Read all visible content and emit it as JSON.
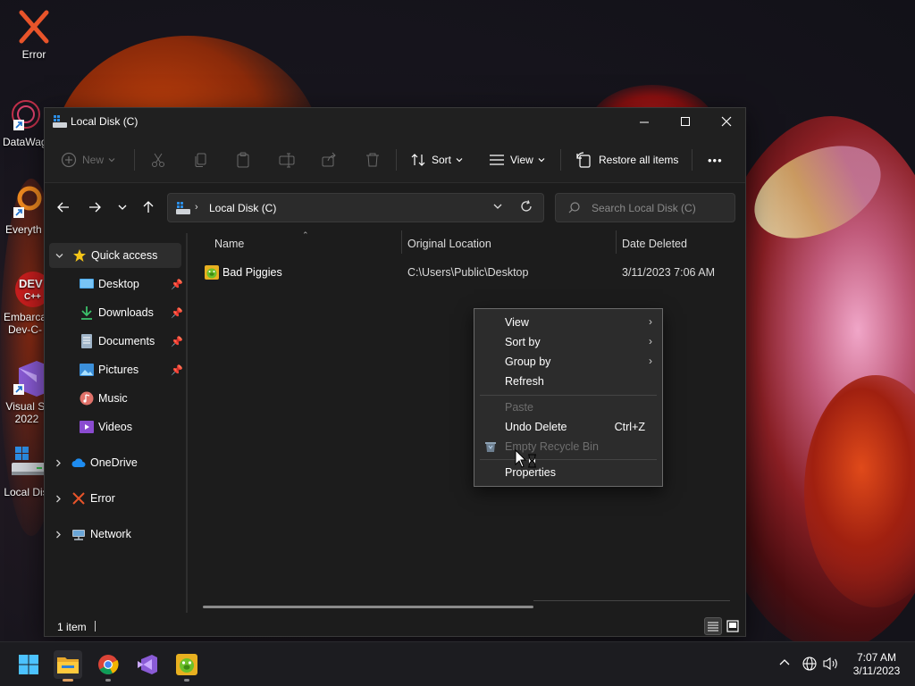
{
  "desktop": {
    "icons": [
      {
        "label": "Error",
        "icon": "red-x-icon"
      },
      {
        "label": "DataWag",
        "icon": "datawag-icon"
      },
      {
        "label": "Everyth",
        "icon": "everything-search-icon"
      },
      {
        "label": "Embarca Dev-C-",
        "icon": "devcpp-icon"
      },
      {
        "label": "Visual St 2022",
        "icon": "visual-studio-icon"
      },
      {
        "label": "Local Dis",
        "icon": "drive-icon"
      }
    ]
  },
  "window": {
    "title": "Local Disk (C)",
    "controls": {
      "minimize": "─",
      "maximize": "☐",
      "close": "✕"
    }
  },
  "toolbar": {
    "new_label": "New",
    "sort_label": "Sort",
    "view_label": "View",
    "restore_label": "Restore all items",
    "more_label": "•••"
  },
  "navigation": {
    "address_text": "Local Disk (C)",
    "search_placeholder": "Search Local Disk (C)"
  },
  "sidebar": {
    "items": [
      {
        "label": "Quick access",
        "icon": "star-icon",
        "expanded": true
      },
      {
        "label": "Desktop",
        "icon": "desktop-folder-icon",
        "pinned": true
      },
      {
        "label": "Downloads",
        "icon": "download-icon",
        "pinned": true
      },
      {
        "label": "Documents",
        "icon": "documents-icon",
        "pinned": true
      },
      {
        "label": "Pictures",
        "icon": "pictures-icon",
        "pinned": true
      },
      {
        "label": "Music",
        "icon": "music-icon"
      },
      {
        "label": "Videos",
        "icon": "videos-icon"
      },
      {
        "label": "OneDrive",
        "icon": "cloud-icon"
      },
      {
        "label": "Error",
        "icon": "red-x-icon"
      },
      {
        "label": "Network",
        "icon": "network-icon"
      }
    ]
  },
  "file_list": {
    "columns": [
      "Name",
      "Original Location",
      "Date Deleted"
    ],
    "rows": [
      {
        "name": "Bad Piggies",
        "location": "C:\\Users\\Public\\Desktop",
        "date": "3/11/2023 7:06 AM"
      }
    ]
  },
  "status": {
    "count": "1 item"
  },
  "context_menu": {
    "items": [
      {
        "label": "View",
        "submenu": true
      },
      {
        "label": "Sort by",
        "submenu": true
      },
      {
        "label": "Group by",
        "submenu": true
      },
      {
        "label": "Refresh"
      },
      {
        "label": "Paste",
        "disabled": true
      },
      {
        "label": "Undo Delete",
        "shortcut": "Ctrl+Z"
      },
      {
        "label": "Empty Recycle Bin",
        "disabled": true
      },
      {
        "label": "Properties"
      }
    ],
    "submenu_arrow": "›"
  },
  "taskbar": {
    "apps": [
      "start-icon",
      "file-explorer-icon",
      "chrome-icon",
      "visual-studio-icon",
      "bad-piggies-icon"
    ],
    "time": "7:07 AM",
    "date": "3/11/2023"
  },
  "colors": {
    "accent": "#60cdff",
    "window_bg": "#1c1c1c",
    "menu_bg": "#2c2c2c"
  }
}
